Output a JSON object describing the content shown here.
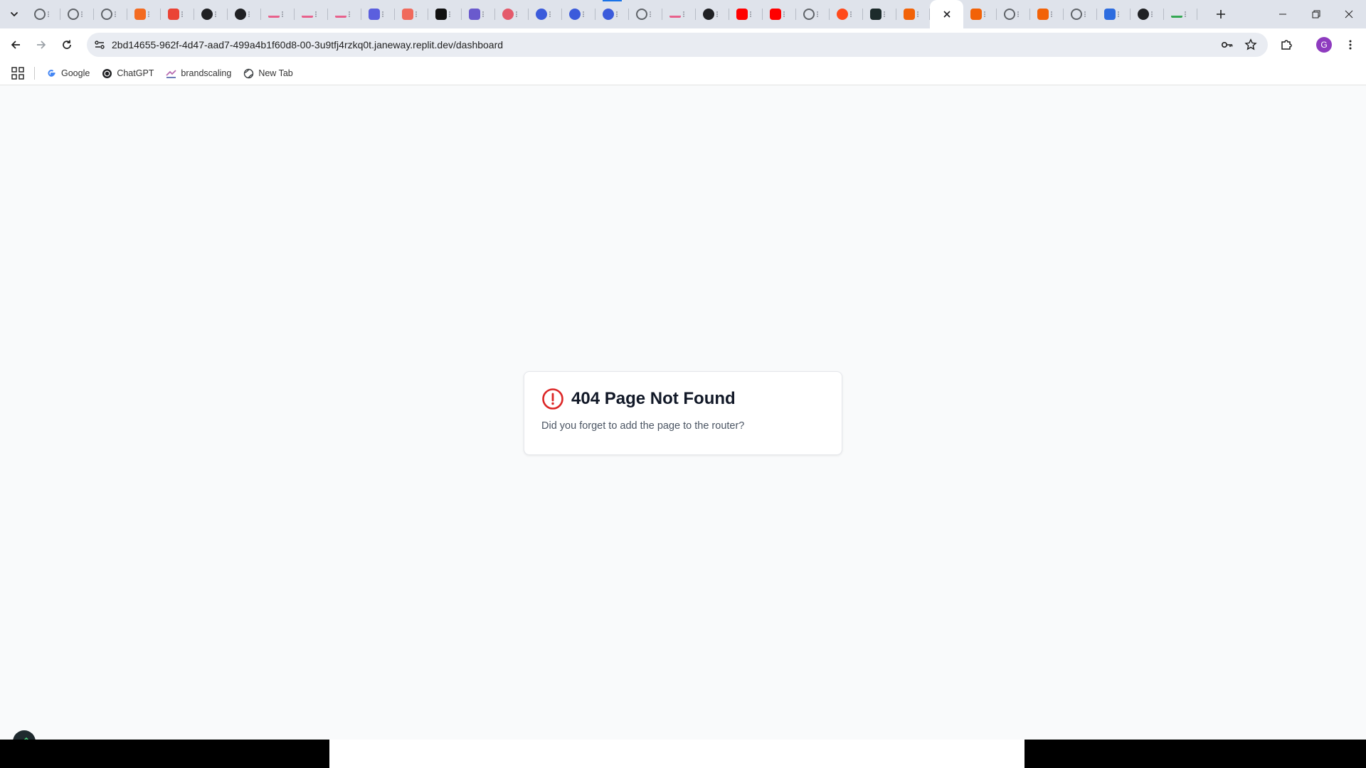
{
  "browser": {
    "tabs": [
      {
        "icon": "gear-icon",
        "color": "#5f6368"
      },
      {
        "icon": "gear-icon",
        "color": "#5f6368"
      },
      {
        "icon": "gear-icon",
        "color": "#5f6368"
      },
      {
        "icon": "orange-logo-icon",
        "color": "#f36b21"
      },
      {
        "icon": "gmail-icon",
        "color": "#ea4335"
      },
      {
        "icon": "openai-icon",
        "color": "#202124"
      },
      {
        "icon": "openai-icon",
        "color": "#202124"
      },
      {
        "icon": "workflow-icon",
        "color": "#e8618c"
      },
      {
        "icon": "workflow-icon",
        "color": "#e8618c"
      },
      {
        "icon": "workflow-icon",
        "color": "#e8618c"
      },
      {
        "icon": "app-icon",
        "color": "#5b5fde"
      },
      {
        "icon": "chat-icon",
        "color": "#f06a5c"
      },
      {
        "icon": "r-icon",
        "color": "#111111"
      },
      {
        "icon": "s-icon",
        "color": "#6a5acd"
      },
      {
        "icon": "target-icon",
        "color": "#e45a6b"
      },
      {
        "icon": "circle-logo-icon",
        "color": "#3b5bdb"
      },
      {
        "icon": "circle-logo-icon",
        "color": "#3b5bdb"
      },
      {
        "icon": "circle-logo-icon",
        "color": "#3b5bdb"
      },
      {
        "icon": "globe-icon",
        "color": "#5f6368"
      },
      {
        "icon": "workflow-icon",
        "color": "#e8618c"
      },
      {
        "icon": "openai-icon",
        "color": "#202124"
      },
      {
        "icon": "youtube-icon",
        "color": "#ff0000"
      },
      {
        "icon": "youtube-icon",
        "color": "#ff0000"
      },
      {
        "icon": "globe-icon",
        "color": "#5f6368"
      },
      {
        "icon": "red-dot-icon",
        "color": "#ff4a1c"
      },
      {
        "icon": "pulse-icon",
        "color": "#1c2b2b"
      },
      {
        "icon": "replit-icon",
        "color": "#f26207"
      },
      {
        "icon": "close-icon",
        "color": "#202124",
        "active": true
      },
      {
        "icon": "replit-icon",
        "color": "#f26207"
      },
      {
        "icon": "globe-icon",
        "color": "#5f6368"
      },
      {
        "icon": "replit-icon",
        "color": "#f26207"
      },
      {
        "icon": "globe-icon",
        "color": "#5f6368"
      },
      {
        "icon": "zm-icon",
        "color": "#2d6cdf"
      },
      {
        "icon": "openai-icon",
        "color": "#202124"
      },
      {
        "icon": "google-icon",
        "color": "#34a853"
      }
    ],
    "url": "2bd14655-962f-4d47-aad7-499a4b1f60d8-00-3u9tfj4rzkq0t.janeway.replit.dev/dashboard",
    "profile_initial": "G",
    "profile_color": "#8e3bbf",
    "bookmarks": [
      {
        "label": "Google",
        "icon": "google-icon"
      },
      {
        "label": "ChatGPT",
        "icon": "openai-icon"
      },
      {
        "label": "brandscaling",
        "icon": "brand-icon"
      },
      {
        "label": "New Tab",
        "icon": "globe-icon"
      }
    ]
  },
  "page": {
    "title": "404 Page Not Found",
    "message": "Did you forget to add the page to the router?",
    "alert_color": "#dc2626"
  }
}
